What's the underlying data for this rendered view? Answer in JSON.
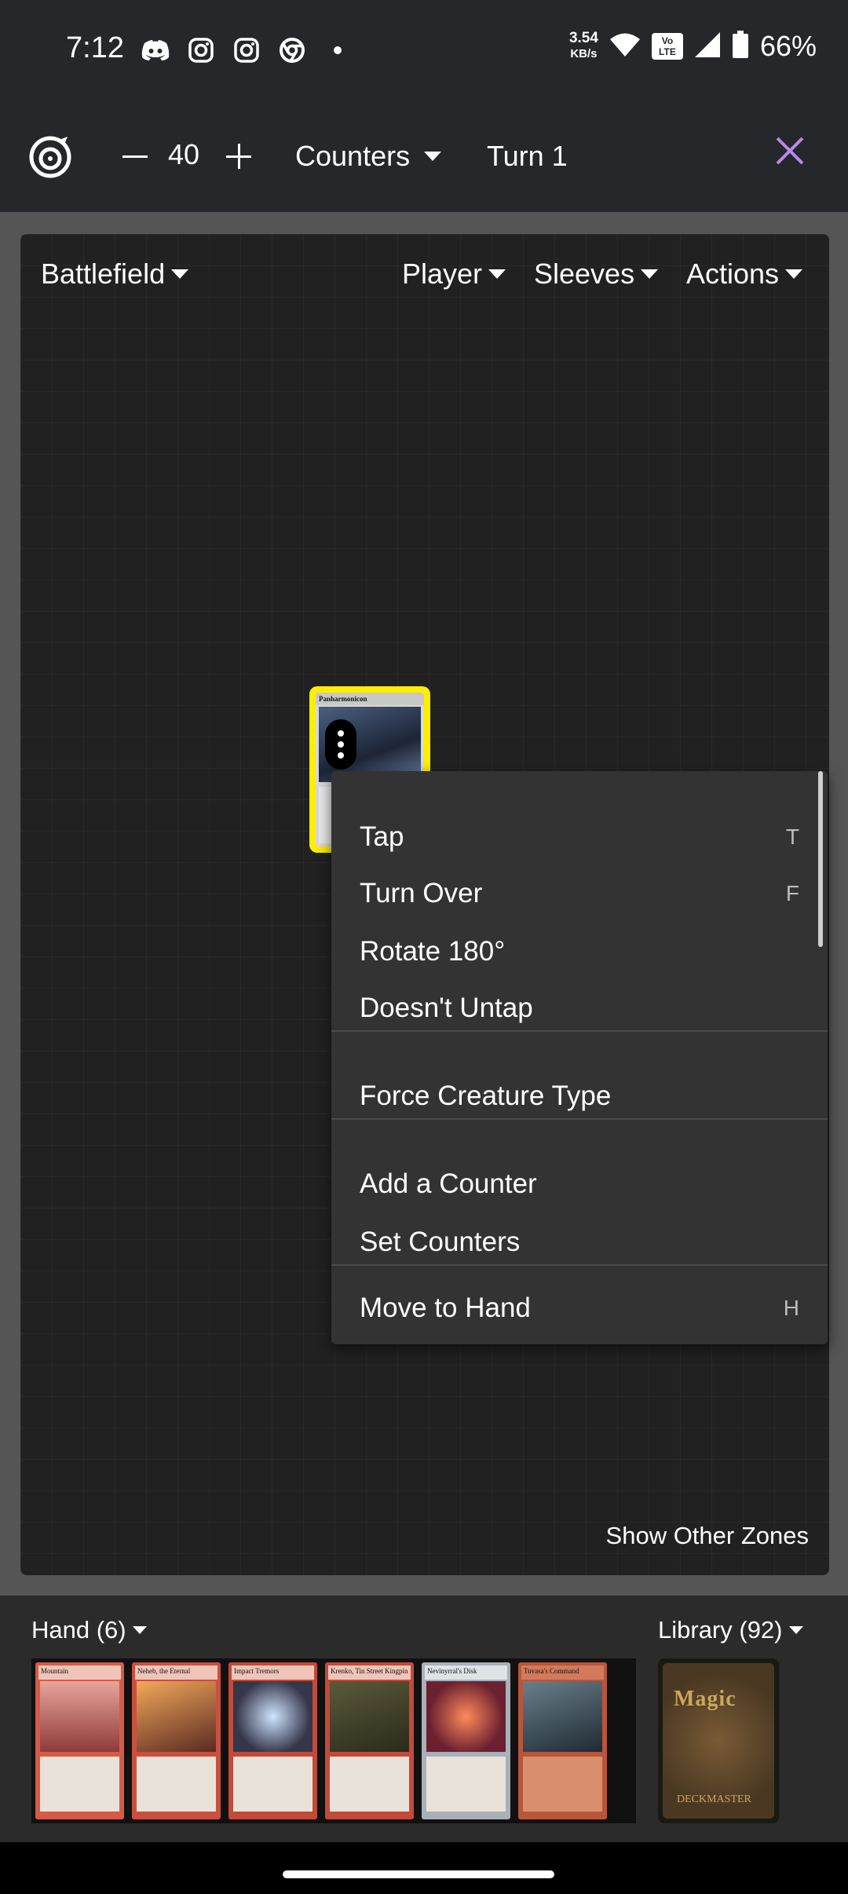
{
  "status_bar": {
    "time": "7:12",
    "left_icons": [
      "discord-icon",
      "instagram-icon",
      "instagram-icon",
      "chrome-icon",
      "dot-icon"
    ],
    "net_speed_value": "3.54",
    "net_speed_unit": "KB/s",
    "volte_top": "Vo",
    "volte_bottom": "LTE",
    "battery_percent": "66%"
  },
  "toolbar": {
    "life_total": "40",
    "counters_label": "Counters",
    "turn_label": "Turn 1",
    "accent_color": "#b78ae8"
  },
  "board": {
    "zone_label": "Battlefield",
    "player_label": "Player",
    "sleeves_label": "Sleeves",
    "actions_label": "Actions",
    "card_name": "Panharmonicon",
    "highlight_color": "#ffee00",
    "show_other_zones": "Show Other Zones"
  },
  "context_menu": {
    "items": [
      {
        "label": "Tap",
        "shortcut": "T"
      },
      {
        "label": "Turn Over",
        "shortcut": "F"
      },
      {
        "label": "Rotate 180°",
        "shortcut": ""
      },
      {
        "label": "Doesn't Untap",
        "shortcut": ""
      },
      {
        "label": "Force Creature Type",
        "shortcut": ""
      },
      {
        "label": "Add a Counter",
        "shortcut": ""
      },
      {
        "label": "Set Counters",
        "shortcut": ""
      },
      {
        "label": "Move to Hand",
        "shortcut": "H"
      }
    ]
  },
  "hand": {
    "label": "Hand (6)",
    "cards": [
      {
        "name": "Mountain",
        "frame": "#d65a48"
      },
      {
        "name": "Neheb, the Eternal",
        "frame": "#c9503e"
      },
      {
        "name": "Impact Tremors",
        "frame": "#c24a3a"
      },
      {
        "name": "Krenko, Tin Street Kingpin",
        "frame": "#c24a3a"
      },
      {
        "name": "Nevinyrral's Disk",
        "frame": "#a9b0b8"
      },
      {
        "name": "Tuvasa's Command",
        "frame": "#b8563a"
      }
    ]
  },
  "library": {
    "label": "Library (92)",
    "logo_text": "Magic",
    "bottom_text": "DECKMASTER"
  }
}
